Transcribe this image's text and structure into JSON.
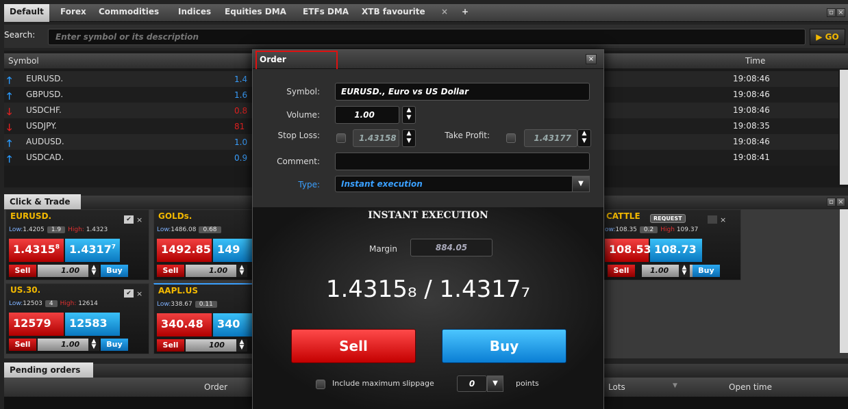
{
  "tabs": [
    "Default",
    "Forex",
    "Commodities",
    "Indices",
    "Equities DMA",
    "ETFs DMA",
    "XTB favourite",
    "+"
  ],
  "search": {
    "label": "Search:",
    "placeholder": "Enter symbol or its description",
    "go": "GO"
  },
  "market": {
    "headers": {
      "symbol": "Symbol",
      "time": "Time"
    },
    "rows": [
      {
        "symbol": "EURUSD.",
        "dir": "up",
        "bid": "1.4",
        "time": "19:08:46"
      },
      {
        "symbol": "GBPUSD.",
        "dir": "up",
        "bid": "1.6",
        "time": "19:08:46"
      },
      {
        "symbol": "USDCHF.",
        "dir": "down",
        "bid": "0.8",
        "time": "19:08:46"
      },
      {
        "symbol": "USDJPY.",
        "dir": "down",
        "bid": "81",
        "time": "19:08:35"
      },
      {
        "symbol": "AUDUSD.",
        "dir": "up",
        "bid": "1.0",
        "time": "19:08:46"
      },
      {
        "symbol": "USDCAD.",
        "dir": "up",
        "bid": "0.9",
        "time": "19:08:41"
      }
    ]
  },
  "click_trade": {
    "title": "Click & Trade",
    "tiles": [
      {
        "symbol": "EURUSD.",
        "low_label": "Low:",
        "low": "1.4205",
        "spread": "1.9",
        "high_label": "High:",
        "high": "1.4323",
        "sell_price": "1.4315",
        "sell_sup": "8",
        "buy_price": "1.4317",
        "buy_sup": "7",
        "sell": "Sell",
        "volume": "1.00",
        "buy": "Buy"
      },
      {
        "symbol": "GOLDs.",
        "low_label": "Low:",
        "low": "1486.08",
        "spread": "0.68",
        "sell_price": "1492.85",
        "buy_price": "149",
        "sell": "Sell",
        "volume": "1.00"
      },
      {
        "symbol": "US.30.",
        "low_label": "Low:",
        "low": "12503",
        "spread": "4",
        "high_label": "High:",
        "high": "12614",
        "sell_price": "12579",
        "buy_price": "12583",
        "sell": "Sell",
        "volume": "1.00",
        "buy": "Buy"
      },
      {
        "symbol": "AAPL.US",
        "low_label": "Low:",
        "low": "338.67",
        "spread": "0.11",
        "sell_price": "340.48",
        "buy_price": "340",
        "sell": "Sell",
        "volume": "100"
      },
      {
        "symbol": "CATTLE",
        "request": "REQUEST",
        "low_label": "ow:",
        "low": "108.35",
        "spread": "0.2",
        "high_label": "High",
        "high": "109.37",
        "sell_price": "108.53",
        "buy_price": "108.73",
        "sell": "Sell",
        "volume": "1.00",
        "buy": "Buy"
      }
    ]
  },
  "pending": {
    "title": "Pending orders",
    "col_order": "Order",
    "col_lots": "Lots",
    "col_open": "Open time"
  },
  "dialog": {
    "title": "Order",
    "close": "×",
    "symbol_label": "Symbol:",
    "symbol_value": "EURUSD., Euro vs US Dollar",
    "volume_label": "Volume:",
    "volume_value": "1.00",
    "sl_label": "Stop Loss:",
    "sl_value": "1.43158",
    "tp_label": "Take Profit:",
    "tp_value": "1.43177",
    "comment_label": "Comment:",
    "comment_value": "",
    "type_label": "Type:",
    "type_value": "Instant execution",
    "exec_title": "INSTANT EXECUTION",
    "margin_label": "Margin",
    "margin_value": "884.05",
    "quote": "1.4315₈ / 1.4317₇",
    "sell": "Sell",
    "buy": "Buy",
    "slippage_label": "Include maximum slippage",
    "slippage_value": "0",
    "points": "points"
  }
}
